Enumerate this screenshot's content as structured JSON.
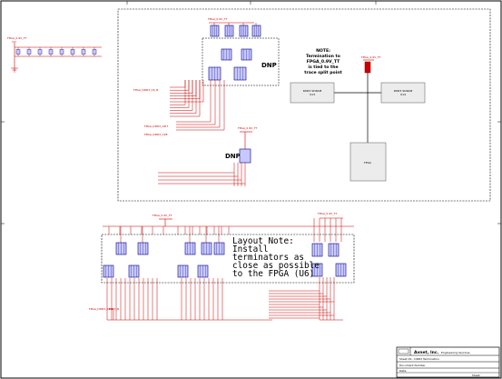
{
  "schematic": {
    "note_title": "NOTE:",
    "note_lines": [
      "Termination to",
      "FPGA_0.9V_TT",
      "is tied to the",
      "trace split point"
    ],
    "power_label_top": "FPGA_0.9V_TT",
    "power_label_sub": "FPGA_0.9V_TT",
    "power_label_left": "FPGA_0.9V_TT",
    "power_label_bottom": "FPGA_0.9V_TT",
    "dnp_label_1": "DNP",
    "dnp_label_2": "DNP",
    "ddr_left": "DDR3 SDRAM",
    "ddr_left_sub": "U13",
    "ddr_right": "DDR3 SDRAM",
    "ddr_right_sub": "U14",
    "fpga_label": "FPGA",
    "layout_note_lines": [
      "Layout Note:",
      "Install",
      "terminators as",
      "close as possible",
      "to the FPGA (U6)"
    ],
    "signal_clk": "FPGA_DDR3_CK_N",
    "signal_odt": "FPGA_DDR3_ODT",
    "signal_cke": "FPGA_DDR3_CKE",
    "signal_bottom": "FPGA_DDR3_RESET_N"
  },
  "title_block": {
    "company": "Avnet, Inc.",
    "division": "Engineering Services",
    "doc_id": "Document Number",
    "sheet_title": "Sheet 29 - DDR3 Termination",
    "date_label": "Date:",
    "sheet_label": "Sheet"
  },
  "colors": {
    "wire": "#cc0000",
    "part": "#000080",
    "part_fill": "#c8c8ff",
    "border": "#000000"
  }
}
